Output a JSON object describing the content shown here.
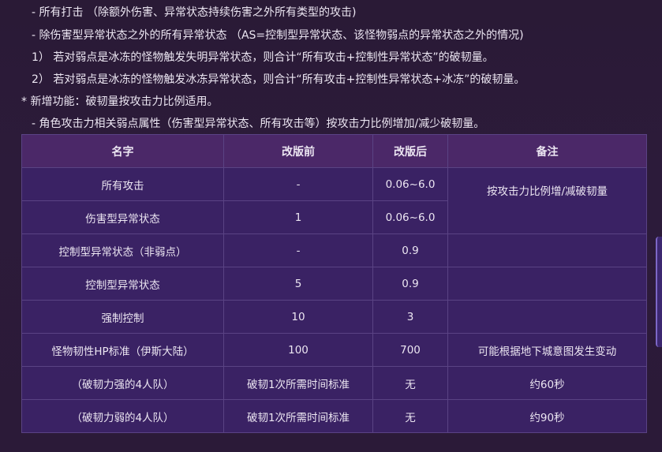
{
  "notes": {
    "lines": [
      "- 所有打击 （除额外伤害、异常状态持续伤害之外所有类型的攻击)",
      "- 除伤害型异常状态之外的所有异常状态 （AS=控制型异常状态、该怪物弱点的异常状态之外的情况)",
      "1） 若对弱点是冰冻的怪物触发失明异常状态，则合计“所有攻击+控制性异常状态”的破韧量。",
      "2） 若对弱点是冰冻的怪物触发冰冻异常状态，则合计“所有攻击+控制性异常状态+冰冻”的破韧量。",
      "* 新增功能：破韧量按攻击力比例适用。",
      "- 角色攻击力相关弱点属性（伤害型异常状态、所有攻击等）按攻击力比例增加/减少破韧量。"
    ]
  },
  "table": {
    "headers": [
      "名字",
      "改版前",
      "改版后",
      "备注"
    ],
    "rows": [
      {
        "name": "所有攻击",
        "before": "-",
        "after": "0.06~6.0",
        "note": "按攻击力比例增/减破韧量"
      },
      {
        "name": "伤害型异常状态",
        "before": "1",
        "after": "0.06~6.0"
      },
      {
        "name": "控制型异常状态（非弱点）",
        "before": "-",
        "after": "0.9",
        "note": ""
      },
      {
        "name": "控制型异常状态",
        "before": "5",
        "after": "0.9",
        "note": ""
      },
      {
        "name": "强制控制",
        "before": "10",
        "after": "3",
        "note": ""
      },
      {
        "name": "怪物韧性HP标准（伊斯大陆）",
        "before": "100",
        "after": "700",
        "note": "可能根据地下城意图发生变动"
      },
      {
        "name": "（破韧力强的4人队）",
        "before": "破韧1次所需时间标准",
        "after": "无",
        "note": "约60秒"
      },
      {
        "name": "（破韧力弱的4人队）",
        "before": "破韧1次所需时间标准",
        "after": "无",
        "note": "约90秒"
      }
    ]
  },
  "colors": {
    "background": "#2b1a38",
    "table_body": "#3a2264",
    "table_header": "#4b2868",
    "grid_line": "#5a4384",
    "text": "#ece6f2"
  }
}
